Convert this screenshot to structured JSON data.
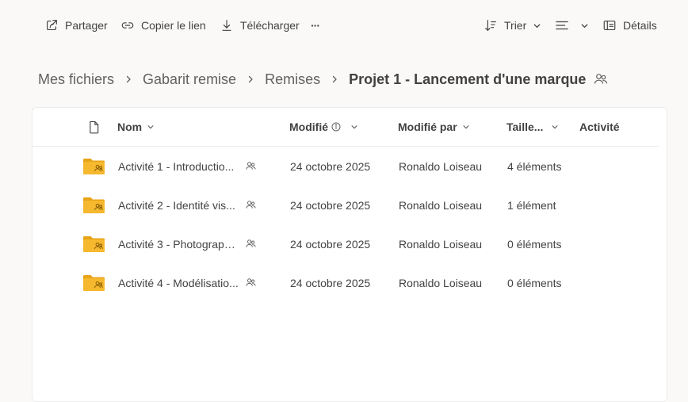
{
  "toolbar": {
    "share": "Partager",
    "copy_link": "Copier le lien",
    "download": "Télécharger",
    "more": "···",
    "sort": "Trier",
    "details": "Détails"
  },
  "breadcrumb": {
    "items": [
      "Mes fichiers",
      "Gabarit remise",
      "Remises"
    ],
    "current": "Projet 1 - Lancement d'une marque"
  },
  "table": {
    "headers": {
      "name": "Nom",
      "modified": "Modifié",
      "modified_by": "Modifié par",
      "size": "Taille...",
      "activity": "Activité"
    },
    "rows": [
      {
        "name": "Activité 1 - Introductio...",
        "modified": "24 octobre 2025",
        "modified_by": "Ronaldo Loiseau",
        "size": "4 éléments",
        "activity": ""
      },
      {
        "name": "Activité 2 - Identité vis...",
        "modified": "24 octobre 2025",
        "modified_by": "Ronaldo Loiseau",
        "size": "1 élément",
        "activity": ""
      },
      {
        "name": "Activité 3 - Photograph...",
        "modified": "24 octobre 2025",
        "modified_by": "Ronaldo Loiseau",
        "size": "0 éléments",
        "activity": ""
      },
      {
        "name": "Activité 4 - Modélisatio...",
        "modified": "24 octobre 2025",
        "modified_by": "Ronaldo Loiseau",
        "size": "0 éléments",
        "activity": ""
      }
    ]
  },
  "icons": {
    "folder": "shared-folder-icon",
    "shared": "people-icon"
  },
  "colors": {
    "folder": "#f5b82e",
    "folder_back": "#e8a317",
    "background": "#faf9f8",
    "panel": "#ffffff"
  }
}
